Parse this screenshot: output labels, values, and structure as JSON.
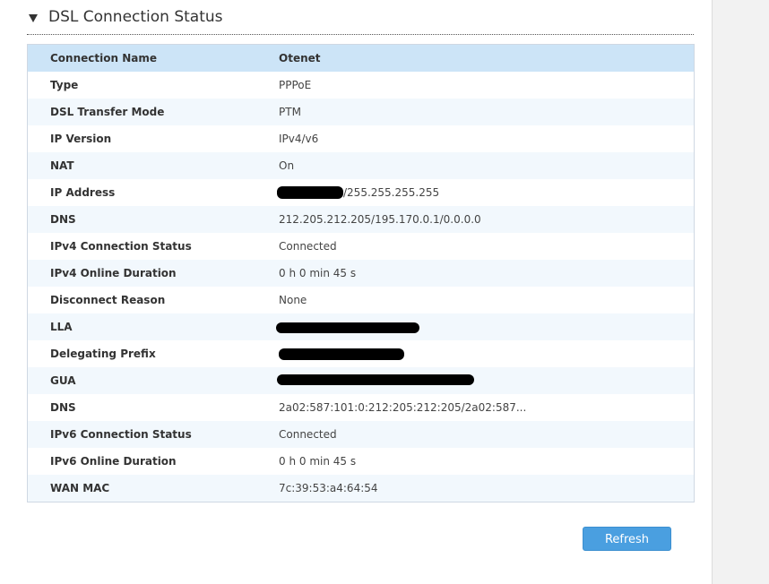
{
  "section": {
    "title": "DSL Connection Status"
  },
  "table": {
    "header": {
      "label": "Connection Name",
      "value": "Otenet"
    },
    "rows": [
      {
        "label": "Type",
        "value": "PPPoE"
      },
      {
        "label": "DSL Transfer Mode",
        "value": "PTM"
      },
      {
        "label": "IP Version",
        "value": "IPv4/v6"
      },
      {
        "label": "NAT",
        "value": "On"
      },
      {
        "label": "IP Address",
        "value": "/255.255.255.255"
      },
      {
        "label": "DNS",
        "value": "212.205.212.205/195.170.0.1/0.0.0.0"
      },
      {
        "label": "IPv4 Connection Status",
        "value": "Connected"
      },
      {
        "label": "IPv4 Online Duration",
        "value": "0 h 0 min 45 s"
      },
      {
        "label": "Disconnect Reason",
        "value": "None"
      },
      {
        "label": "LLA",
        "value": ""
      },
      {
        "label": "Delegating Prefix",
        "value": ""
      },
      {
        "label": "GUA",
        "value": ""
      },
      {
        "label": "DNS",
        "value": "2a02:587:101:0:212:205:212:205/2a02:587..."
      },
      {
        "label": "IPv6 Connection Status",
        "value": "Connected"
      },
      {
        "label": "IPv6 Online Duration",
        "value": "0 h 0 min 45 s"
      },
      {
        "label": "WAN MAC",
        "value": "7c:39:53:a4:64:54"
      }
    ]
  },
  "actions": {
    "refresh_label": "Refresh"
  }
}
